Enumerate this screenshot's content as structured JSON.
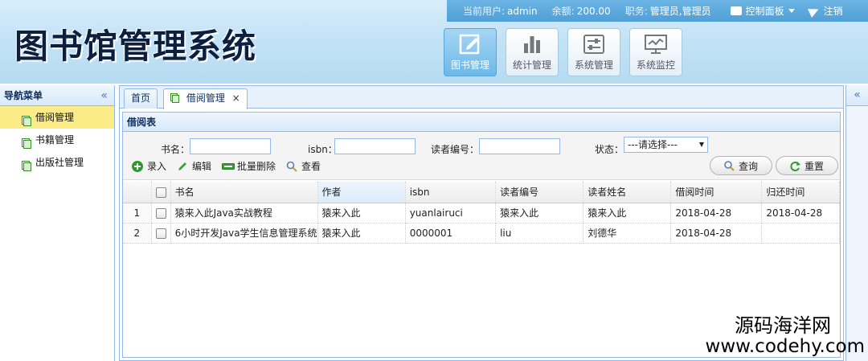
{
  "app": {
    "title": "图书馆管理系统"
  },
  "topbar": {
    "current_user_label": "当前用户:",
    "current_user": "admin",
    "balance_label": "余额:",
    "balance": "200.00",
    "role_label": "职务:",
    "role": "管理员,管理员",
    "control_panel": "控制面板",
    "logout": "注销"
  },
  "modules": [
    {
      "label": "图书管理",
      "icon": "edit-icon",
      "active": true
    },
    {
      "label": "统计管理",
      "icon": "bar-chart-icon",
      "active": false
    },
    {
      "label": "系统管理",
      "icon": "settings-icon",
      "active": false
    },
    {
      "label": "系统监控",
      "icon": "monitor-icon",
      "active": false
    }
  ],
  "sidebar": {
    "title": "导航菜单",
    "collapse_glyph": "«",
    "items": [
      {
        "label": "借阅管理",
        "active": true
      },
      {
        "label": "书籍管理",
        "active": false
      },
      {
        "label": "出版社管理",
        "active": false
      }
    ]
  },
  "rightbar": {
    "expand_glyph": "«"
  },
  "tabs": [
    {
      "label": "首页",
      "selected": false
    },
    {
      "label": "借阅管理",
      "selected": true,
      "close": "×"
    }
  ],
  "panel": {
    "title": "借阅表"
  },
  "search": {
    "book_name_label": "书名：",
    "isbn_label": "isbn：",
    "reader_no_label": "读者编号：",
    "status_label": "状态：",
    "status_value": "---请选择---",
    "query_button": "查询",
    "reset_button": "重置"
  },
  "actions": {
    "add": "录入",
    "edit": "编辑",
    "batch_delete": "批量删除",
    "view": "查看"
  },
  "table": {
    "columns": [
      "书名",
      "作者",
      "isbn",
      "读者编号",
      "读者姓名",
      "借阅时间",
      "归还时间"
    ],
    "rows": [
      {
        "n": "1",
        "cells": [
          "猿来入此Java实战教程",
          "猿来入此",
          "yuanlairuci",
          "猿来入此",
          "猿来入此",
          "2018-04-28",
          "2018-04-28"
        ]
      },
      {
        "n": "2",
        "cells": [
          "6小时开发Java学生信息管理系统",
          "猿来入此",
          "0000001",
          "liu",
          "刘德华",
          "2018-04-28",
          ""
        ]
      }
    ]
  },
  "watermark": {
    "line1": "源码海洋网",
    "line2": "www.codehy.com"
  },
  "colors": {
    "accent": "#4f9fd6",
    "border": "#95b8e7",
    "selected_row": "#fbec88"
  }
}
